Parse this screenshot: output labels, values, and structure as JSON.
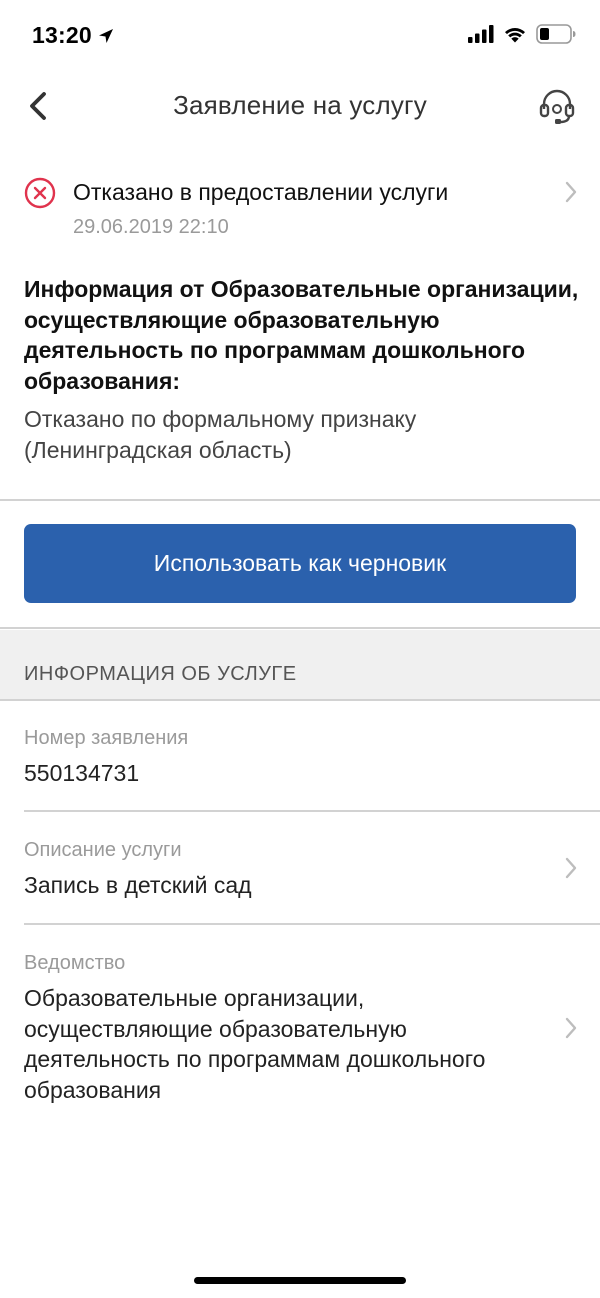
{
  "status_bar": {
    "time": "13:20"
  },
  "nav": {
    "title": "Заявление на услугу",
    "back_icon": "chevron-left-icon",
    "support_icon": "headset-icon"
  },
  "status": {
    "title": "Отказано в предоставлении услуги",
    "date": "29.06.2019 22:10",
    "icon": "error-circle-icon",
    "icon_color": "#e0334d"
  },
  "info": {
    "heading": "Информация от Образовательные организации, осуществляющие образовательную деятельность по программам дошкольного образования:",
    "text": "Отказано по формальному признаку (Ленинградская область)"
  },
  "actions": {
    "draft_label": "Использовать как черновик",
    "accent_color": "#2b61ad"
  },
  "service_info": {
    "section_title": "ИНФОРМАЦИЯ ОБ УСЛУГЕ",
    "rows": [
      {
        "label": "Номер заявления",
        "value": "550134731"
      },
      {
        "label": "Описание услуги",
        "value": "Запись в детский сад"
      },
      {
        "label": "Ведомство",
        "value": "Образовательные организации, осуществляющие образовательную деятельность по программам дошкольного образования"
      }
    ]
  }
}
